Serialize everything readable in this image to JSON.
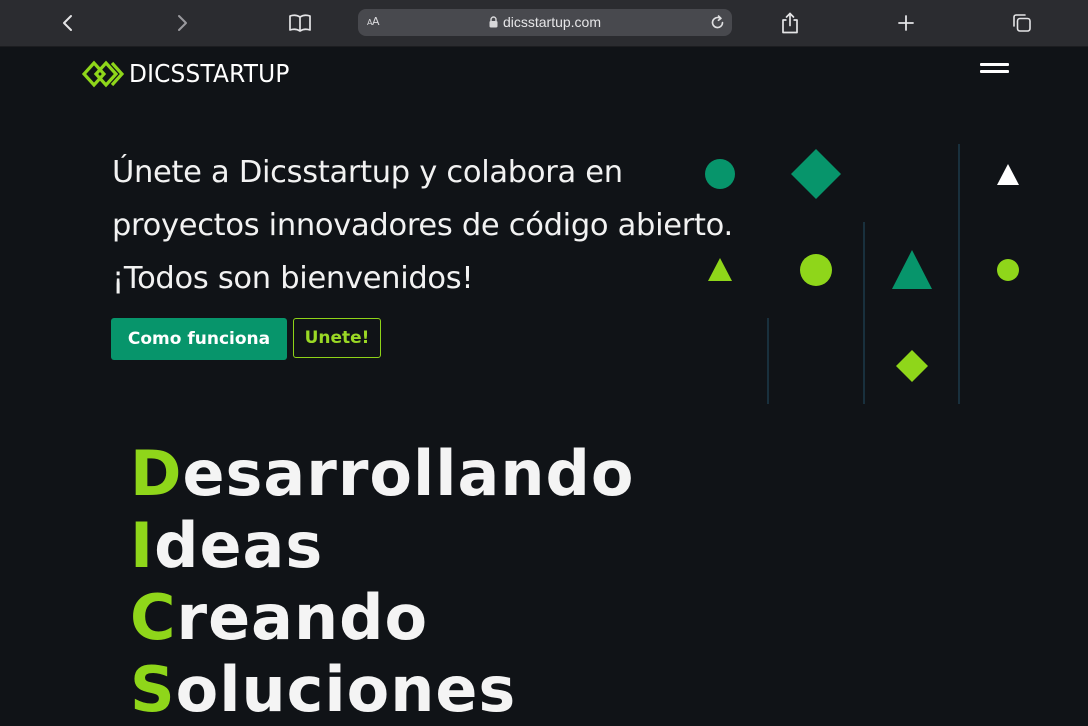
{
  "browser": {
    "text_size_label": "AA",
    "url": "dicsstartup.com"
  },
  "header": {
    "logo_text": "DICSSTARTUP"
  },
  "hero": {
    "lines": [
      "Únete a Dicsstartup y colabora en",
      "proyectos innovadores de código abierto.",
      "¡Todos son bienvenidos!"
    ],
    "primary_button": "Como funciona",
    "secondary_button": "Unete!"
  },
  "tagline": [
    {
      "initial": "D",
      "rest": "esarrollando"
    },
    {
      "initial": "I",
      "rest": "deas"
    },
    {
      "initial": "C",
      "rest": "reando"
    },
    {
      "initial": "S",
      "rest": "oluciones"
    }
  ],
  "colors": {
    "background": "#101317",
    "green_dark": "#07956b",
    "green_lime": "#8fd61a",
    "text_white": "#f4f4f4",
    "divider_line": "#1c3a4a"
  },
  "icons": {
    "back": "chevron-left-icon",
    "forward": "chevron-right-icon",
    "reader": "book-icon",
    "lock": "lock-icon",
    "reload": "reload-icon",
    "share": "share-icon",
    "new_tab": "plus-icon",
    "tabs": "tabs-icon",
    "menu": "hamburger-icon"
  }
}
